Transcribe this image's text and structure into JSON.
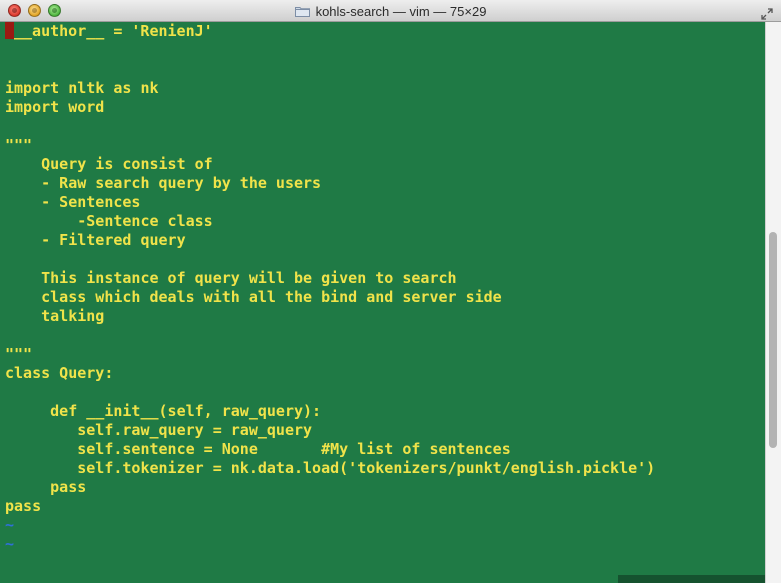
{
  "window": {
    "title": "kohls-search — vim — 75×29"
  },
  "editor": {
    "lines": [
      "__author__ = 'RenienJ'",
      "",
      "",
      "import nltk as nk",
      "import word",
      "",
      "\"\"\"",
      "    Query is consist of",
      "    - Raw search query by the users",
      "    - Sentences",
      "        -Sentence class",
      "    - Filtered query",
      "",
      "    This instance of query will be given to search",
      "    class which deals with all the bind and server side",
      "    talking",
      "",
      "\"\"\"",
      "class Query:",
      "",
      "     def __init__(self, raw_query):",
      "        self.raw_query = raw_query",
      "        self.sentence = None       #My list of sentences",
      "        self.tokenizer = nk.data.load('tokenizers/punkt/english.pickle')",
      "     pass",
      "pass"
    ],
    "empty_line_markers": [
      "~",
      "~"
    ]
  },
  "scrollbar": {
    "position_fraction": 0.61,
    "visible_fraction": 0.39
  },
  "colors": {
    "background": "#1f7a45",
    "text": "#f0e34a",
    "cursor": "#9a1a12",
    "tilde": "#2f6fd8"
  },
  "icons": {
    "title_icon": "folder-icon",
    "fullscreen": "fullscreen-icon"
  }
}
